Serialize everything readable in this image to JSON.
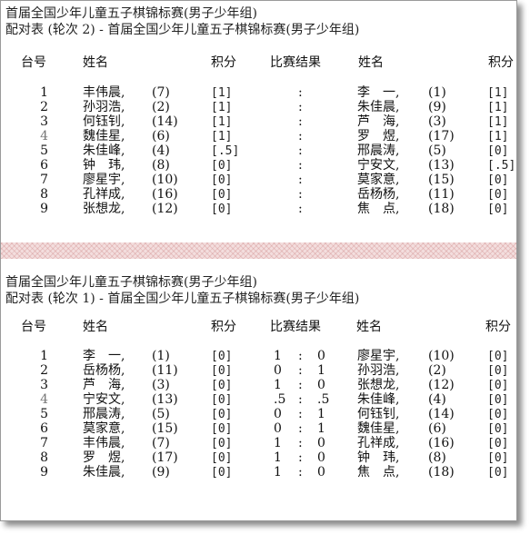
{
  "round2": {
    "title": "首届全国少年儿童五子棋锦标赛(男子少年组)",
    "subtitle": "配对表   (轮次 2)  -  首届全国少年儿童五子棋锦标赛(男子少年组)",
    "headers": {
      "table": "台号",
      "name1": "姓名",
      "score1": "积分",
      "result": "比赛结果",
      "name2": "姓名",
      "score2": "积分"
    },
    "rows": [
      {
        "no": "1",
        "name1": "丰伟晨,",
        "seed1": "(7)",
        "pts1": "[1]",
        "res_a": "",
        "sep": ":",
        "res_b": "",
        "name2": "李　一,",
        "seed2": "(1)",
        "pts2": "[1]"
      },
      {
        "no": "2",
        "name1": "孙羽浩,",
        "seed1": "(2)",
        "pts1": "[1]",
        "res_a": "",
        "sep": ":",
        "res_b": "",
        "name2": "朱佳晨,",
        "seed2": "(9)",
        "pts2": "[1]"
      },
      {
        "no": "3",
        "name1": "何钰钊,",
        "seed1": "(14)",
        "pts1": "[1]",
        "res_a": "",
        "sep": ":",
        "res_b": "",
        "name2": "芦　海,",
        "seed2": "(3)",
        "pts2": "[1]"
      },
      {
        "no": "4",
        "name1": "魏佳星,",
        "seed1": "(6)",
        "pts1": "[1]",
        "res_a": "",
        "sep": ":",
        "res_b": "",
        "name2": "罗　煜,",
        "seed2": "(17)",
        "pts2": "[1]"
      },
      {
        "no": "5",
        "name1": "朱佳峰,",
        "seed1": "(4)",
        "pts1": "[.5]",
        "res_a": "",
        "sep": ":",
        "res_b": "",
        "name2": "邢晨涛,",
        "seed2": "(5)",
        "pts2": "[0]"
      },
      {
        "no": "6",
        "name1": "钟　玮,",
        "seed1": "(8)",
        "pts1": "[0]",
        "res_a": "",
        "sep": ":",
        "res_b": "",
        "name2": "宁安文,",
        "seed2": "(13)",
        "pts2": "[.5]"
      },
      {
        "no": "7",
        "name1": "廖星宇,",
        "seed1": "(10)",
        "pts1": "[0]",
        "res_a": "",
        "sep": ":",
        "res_b": "",
        "name2": "莫家意,",
        "seed2": "(15)",
        "pts2": "[0]"
      },
      {
        "no": "8",
        "name1": "孔祥成,",
        "seed1": "(16)",
        "pts1": "[0]",
        "res_a": "",
        "sep": ":",
        "res_b": "",
        "name2": "岳杨杨,",
        "seed2": "(11)",
        "pts2": "[0]"
      },
      {
        "no": "9",
        "name1": "张想龙,",
        "seed1": "(12)",
        "pts1": "[0]",
        "res_a": "",
        "sep": ":",
        "res_b": "",
        "name2": "焦　点,",
        "seed2": "(18)",
        "pts2": "[0]"
      }
    ]
  },
  "round1": {
    "title": "首届全国少年儿童五子棋锦标赛(男子少年组)",
    "subtitle": "配对表   (轮次 1)  -  首届全国少年儿童五子棋锦标赛(男子少年组)",
    "headers": {
      "table": "台号",
      "name1": "姓名",
      "score1": "积分",
      "result": "比赛结果",
      "name2": "姓名",
      "score2": "积分"
    },
    "rows": [
      {
        "no": "1",
        "name1": "李　一,",
        "seed1": "(1)",
        "pts1": "[0]",
        "res_a": "1",
        "sep": ":",
        "res_b": "0",
        "name2": "廖星宇,",
        "seed2": "(10)",
        "pts2": "[0]"
      },
      {
        "no": "2",
        "name1": "岳杨杨,",
        "seed1": "(11)",
        "pts1": "[0]",
        "res_a": "0",
        "sep": ":",
        "res_b": "1",
        "name2": "孙羽浩,",
        "seed2": "(2)",
        "pts2": "[0]"
      },
      {
        "no": "3",
        "name1": "芦　海,",
        "seed1": "(3)",
        "pts1": "[0]",
        "res_a": "1",
        "sep": ":",
        "res_b": "0",
        "name2": "张想龙,",
        "seed2": "(12)",
        "pts2": "[0]"
      },
      {
        "no": "4",
        "name1": "宁安文,",
        "seed1": "(13)",
        "pts1": "[0]",
        "res_a": ".5",
        "sep": ":",
        "res_b": ".5",
        "name2": "朱佳峰,",
        "seed2": "(4)",
        "pts2": "[0]"
      },
      {
        "no": "5",
        "name1": "邢晨涛,",
        "seed1": "(5)",
        "pts1": "[0]",
        "res_a": "0",
        "sep": ":",
        "res_b": "1",
        "name2": "何钰钊,",
        "seed2": "(14)",
        "pts2": "[0]"
      },
      {
        "no": "6",
        "name1": "莫家意,",
        "seed1": "(15)",
        "pts1": "[0]",
        "res_a": "0",
        "sep": ":",
        "res_b": "1",
        "name2": "魏佳星,",
        "seed2": "(6)",
        "pts2": "[0]"
      },
      {
        "no": "7",
        "name1": "丰伟晨,",
        "seed1": "(7)",
        "pts1": "[0]",
        "res_a": "1",
        "sep": ":",
        "res_b": "0",
        "name2": "孔祥成,",
        "seed2": "(16)",
        "pts2": "[0]"
      },
      {
        "no": "8",
        "name1": "罗　煜,",
        "seed1": "(17)",
        "pts1": "[0]",
        "res_a": "1",
        "sep": ":",
        "res_b": "0",
        "name2": "钟　玮,",
        "seed2": "(8)",
        "pts2": "[0]"
      },
      {
        "no": "9",
        "name1": "朱佳晨,",
        "seed1": "(9)",
        "pts1": "[0]",
        "res_a": "1",
        "sep": ":",
        "res_b": "0",
        "name2": "焦　点,",
        "seed2": "(18)",
        "pts2": "[0]"
      }
    ]
  },
  "colors": {
    "divider": "#f3dede",
    "frame_border": "#9a9a9a"
  }
}
